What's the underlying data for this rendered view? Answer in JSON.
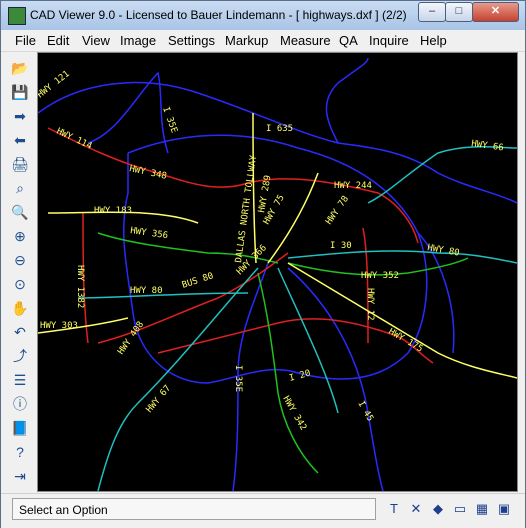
{
  "window": {
    "title": "CAD Viewer 9.0 - Licensed to Bauer Lindemann  -  [ highways.dxf ] (2/2)",
    "controls": {
      "minimize": "–",
      "maximize": "□",
      "close": "✕"
    }
  },
  "menu": [
    "File",
    "Edit",
    "View",
    "Image",
    "Settings",
    "Markup",
    "Measure",
    "QA",
    "Inquire",
    "Help"
  ],
  "toolbar": [
    {
      "name": "open-folder-icon",
      "glyph": "📂"
    },
    {
      "name": "save-disk-icon",
      "glyph": "💾"
    },
    {
      "name": "forward-arrow-icon",
      "glyph": "➡"
    },
    {
      "name": "back-arrow-icon",
      "glyph": "⬅"
    },
    {
      "name": "print-icon",
      "glyph": "🖨"
    },
    {
      "name": "binoculars-icon",
      "glyph": "⌕"
    },
    {
      "name": "magnify-icon",
      "glyph": "🔍"
    },
    {
      "name": "zoom-in-icon",
      "glyph": "⊕"
    },
    {
      "name": "zoom-out-icon",
      "glyph": "⊖"
    },
    {
      "name": "zoom-fit-icon",
      "glyph": "⊙"
    },
    {
      "name": "pan-hand-icon",
      "glyph": "✋"
    },
    {
      "name": "undo-icon",
      "glyph": "↶"
    },
    {
      "name": "axes-icon",
      "glyph": "⤴"
    },
    {
      "name": "layers-sliders-icon",
      "glyph": "☰"
    },
    {
      "name": "info-icon",
      "glyph": "ⓘ"
    },
    {
      "name": "book-icon",
      "glyph": "📘"
    },
    {
      "name": "help-icon",
      "glyph": "?"
    },
    {
      "name": "exit-icon",
      "glyph": "⇥"
    }
  ],
  "status": {
    "message": "Select an Option",
    "tools": [
      {
        "name": "text-tool-icon",
        "glyph": "T"
      },
      {
        "name": "close-x-icon",
        "glyph": "✕"
      },
      {
        "name": "color-cube-icon",
        "glyph": "◆"
      },
      {
        "name": "window-icon",
        "glyph": "▭"
      },
      {
        "name": "palette-icon",
        "glyph": "▦"
      },
      {
        "name": "screen-icon",
        "glyph": "▣"
      }
    ]
  },
  "colors": {
    "background": "#000000",
    "road_blue": "#2a2aff",
    "road_red": "#e02020",
    "road_green": "#20c020",
    "road_cyan": "#20c0c0",
    "road_yellow": "#ffff66"
  },
  "labels": [
    "HWY 121",
    "HWY 114",
    "I 35E",
    "I 635",
    "HWY 66",
    "HWY 348",
    "HWY 289",
    "DALLAS NORTH TOLLWAY",
    "HWY 183",
    "HWY 356",
    "HWY 244",
    "HWY 78",
    "HWY 75",
    "I 30",
    "HWY 80",
    "HWY 366",
    "BUS 80",
    "HWY 80",
    "HWY 352",
    "HWY 1382",
    "HWY 303",
    "HWY 408",
    "HWY 12",
    "HWY 175",
    "HWY 67",
    "I 35E",
    "I 20",
    "HWY 342",
    "I 45"
  ]
}
